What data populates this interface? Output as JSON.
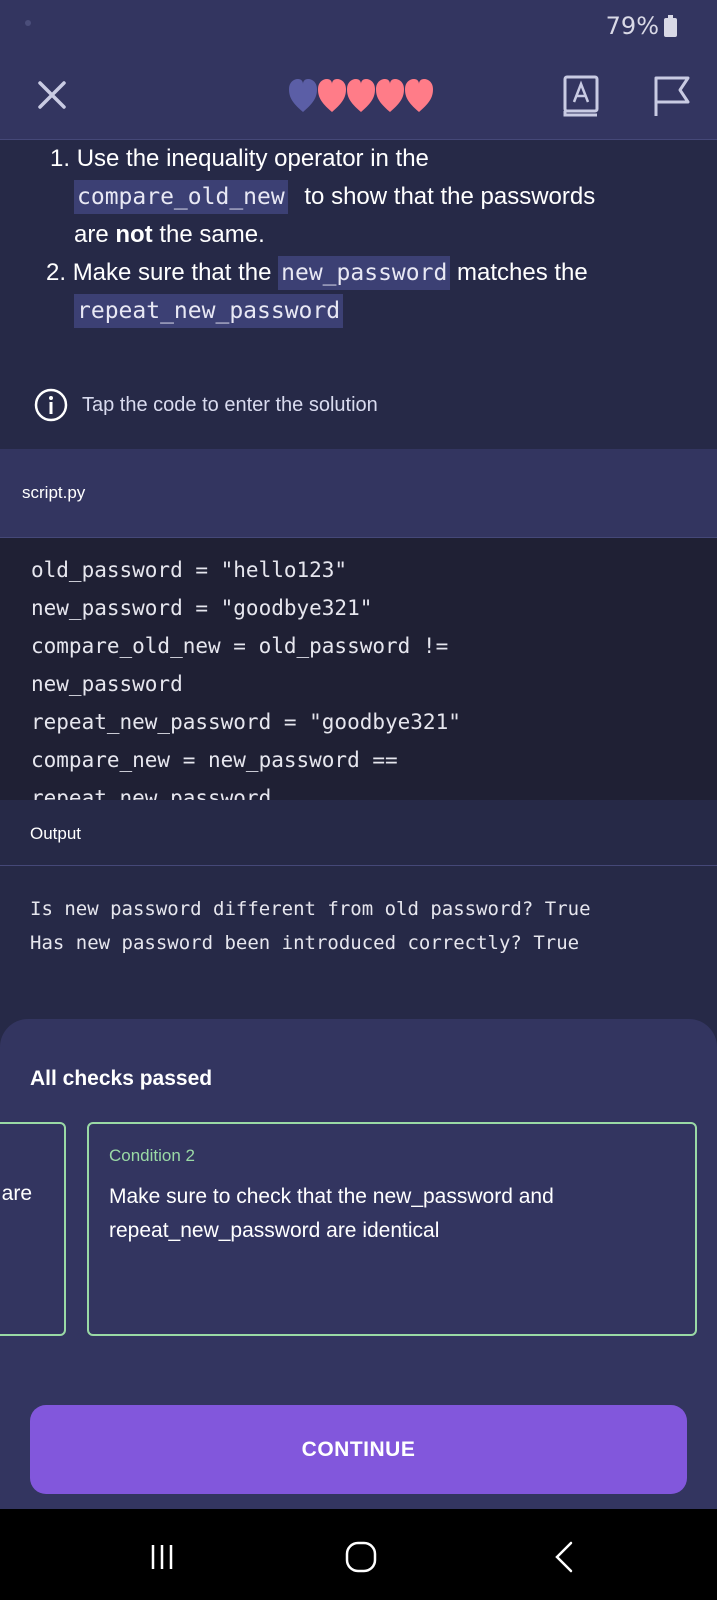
{
  "status": {
    "battery": "79%"
  },
  "header": {
    "hearts_total": 5,
    "hearts_filled": 4
  },
  "instructions": {
    "item1_num": "1.",
    "item1_line1": "Use the inequality operator in the",
    "item1_code": "compare_old_new",
    "item1_line2_rest": "to show that the passwords",
    "item1_line3_a": "are",
    "item1_line3_bold": "not",
    "item1_line3_b": "the same.",
    "item2_num": "2.",
    "item2_text_a": "Make sure that the",
    "item2_code1": "new_password",
    "item2_text_b": "matches the",
    "item2_code2": "repeat_new_password"
  },
  "hint": {
    "text": "Tap the code to enter the solution",
    "icon": "info-icon"
  },
  "editor": {
    "file_name": "script.py",
    "lines": [
      "old_password = \"hello123\"",
      "new_password = \"goodbye321\"",
      "compare_old_new = old_password !=",
      "new_password",
      "repeat_new_password = \"goodbye321\"",
      "compare_new = new_password ==",
      "repeat_new_password"
    ]
  },
  "output": {
    "label": "Output",
    "lines": [
      "Is new password different from old password? True",
      "Has new password been introduced correctly? True"
    ]
  },
  "result": {
    "title": "All checks passed",
    "prev_card_fragment": "are",
    "card_title": "Condition 2",
    "card_body": "Make sure to check that the new_password and repeat_new_password are identical",
    "accent_color": "#9ad9a5"
  },
  "continue_label": "CONTINUE"
}
